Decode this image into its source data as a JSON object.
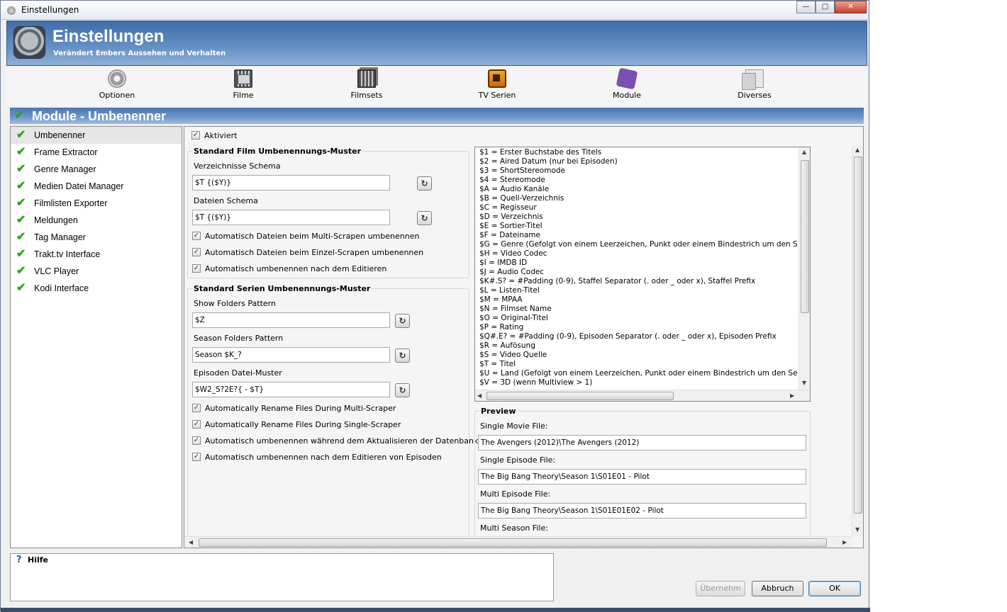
{
  "window": {
    "title": "Einstellungen"
  },
  "header": {
    "title": "Einstellungen",
    "subtitle": "Verändert Embers Aussehen und Verhalten"
  },
  "toolbar": {
    "items": [
      {
        "label": "Optionen",
        "icon": "gear-icon"
      },
      {
        "label": "Filme",
        "icon": "film-icon"
      },
      {
        "label": "Filmsets",
        "icon": "filmsets-icon"
      },
      {
        "label": "TV Serien",
        "icon": "tv-icon"
      },
      {
        "label": "Module",
        "icon": "puzzle-icon"
      },
      {
        "label": "Diverses",
        "icon": "documents-icon"
      }
    ]
  },
  "section": {
    "title": "Module - Umbenenner"
  },
  "sidebar": {
    "items": [
      {
        "label": "Umbenenner",
        "selected": true
      },
      {
        "label": "Frame Extractor"
      },
      {
        "label": "Genre Manager"
      },
      {
        "label": "Medien Datei Manager"
      },
      {
        "label": "Filmlisten Exporter"
      },
      {
        "label": "Meldungen"
      },
      {
        "label": "Tag Manager"
      },
      {
        "label": "Trakt.tv Interface"
      },
      {
        "label": "VLC Player"
      },
      {
        "label": "Kodi Interface"
      }
    ]
  },
  "panel": {
    "enabled_label": "Aktiviert",
    "enabled": true,
    "movie_group": {
      "title": "Standard Film Umbenennungs-Muster",
      "folder_label": "Verzeichnisse Schema",
      "folder_value": "$T {($Y)}",
      "file_label": "Dateien Schema",
      "file_value": "$T {($Y)}",
      "checks": [
        {
          "label": "Automatisch Dateien beim Multi-Scrapen umbenennen",
          "checked": true
        },
        {
          "label": "Automatisch Dateien beim Einzel-Scrapen umbenennen",
          "checked": true
        },
        {
          "label": "Automatisch umbenennen nach dem Editieren",
          "checked": true
        }
      ]
    },
    "series_group": {
      "title": "Standard Serien Umbenennungs-Muster",
      "show_label": "Show Folders Pattern",
      "show_value": "$Z",
      "season_label": "Season Folders Pattern",
      "season_value": "Season $K_?",
      "episode_label": "Episoden Datei-Muster",
      "episode_value": "$W2_S?2E?{ - $T}",
      "checks": [
        {
          "label": "Automatically Rename Files During Multi-Scraper",
          "checked": true
        },
        {
          "label": "Automatically Rename Files During Single-Scraper",
          "checked": true
        },
        {
          "label": "Automatisch umbenennen während dem Aktualisieren der Datenbank",
          "checked": true
        },
        {
          "label": "Automatisch umbenennen nach dem Editieren von Episoden",
          "checked": true
        }
      ]
    },
    "variables": [
      "$1 = Erster Buchstabe des Titels",
      "$2 = Aired Datum (nur bei Episoden)",
      "$3 = ShortStereomode",
      "$4 = Stereomode",
      "$A = Audio Kanäle",
      "$B = Quell-Verzeichnis",
      "$C = Regisseur",
      "$D = Verzeichnis",
      "$E = Sortier-Titel",
      "$F = Dateiname",
      "$G = Genre (Gefolgt von einem Leerzeichen, Punkt oder einem Bindestrich um den Seper",
      "$H = Video Codec",
      "$I = IMDB ID",
      "$J = Audio Codec",
      "$K#.S? = #Padding (0-9), Staffel Separator (. oder _ oder x), Staffel Prefix",
      "$L = Listen-Titel",
      "$M = MPAA",
      "$N = Filmset Name",
      "$O = Original-Titel",
      "$P = Rating",
      "$Q#.E? = #Padding (0-9), Episoden Separator (. oder _ oder x), Episoden Prefix",
      "$R = Aufösung",
      "$S = Video Quelle",
      "$T = Titel",
      "$U = Land (Gefolgt von einem Leerzeichen, Punkt oder einem Bindestrich um den Seper",
      "$V = 3D (wenn Multiview > 1)"
    ],
    "preview": {
      "title": "Preview",
      "single_movie_label": "Single Movie File:",
      "single_movie_value": "The Avengers (2012)\\The Avengers (2012)",
      "single_episode_label": "Single Episode File:",
      "single_episode_value": "The Big Bang Theory\\Season 1\\S01E01 - Pilot",
      "multi_episode_label": "Multi Episode File:",
      "multi_episode_value": "The Big Bang Theory\\Season 1\\S01E01E02 - Pilot",
      "multi_season_label": "Multi Season File:"
    }
  },
  "help": {
    "title": "Hilfe"
  },
  "buttons": {
    "apply": "Übernehm",
    "cancel": "Abbruch",
    "ok": "OK"
  }
}
